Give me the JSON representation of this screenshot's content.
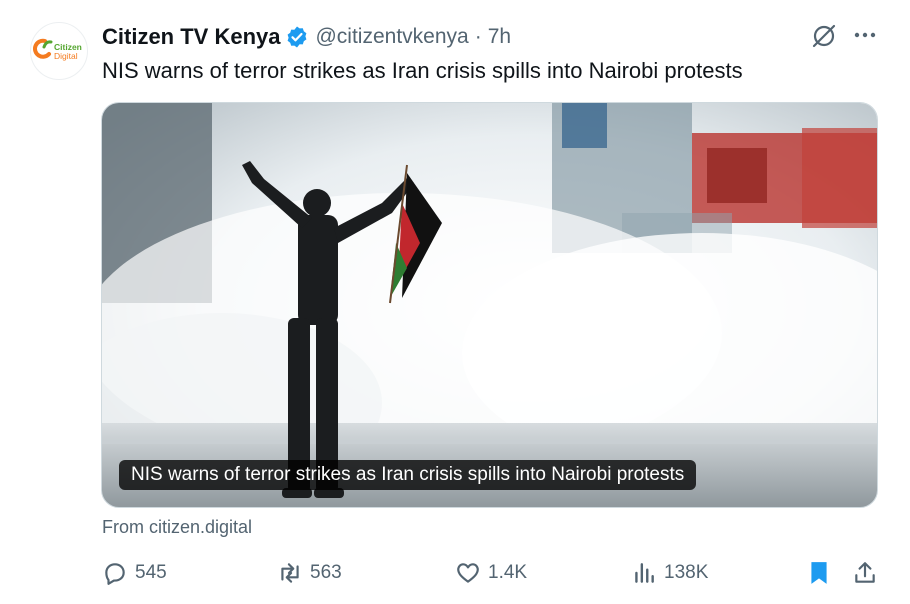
{
  "post": {
    "author_name": "Citizen TV Kenya",
    "handle": "@citizentvkenya",
    "separator": "·",
    "time": "7h",
    "text": "NIS warns of terror strikes as Iran crisis spills into Nairobi protests",
    "avatar_logo_text": [
      "Citizen",
      "Digital"
    ]
  },
  "card": {
    "caption": "NIS warns of terror strikes as Iran crisis spills into Nairobi protests",
    "source": "From citizen.digital"
  },
  "actions": {
    "replies": "545",
    "reposts": "563",
    "likes": "1.4K",
    "views": "138K"
  },
  "icons": {
    "verified": "verified-badge-icon",
    "grok": "grok-icon",
    "more": "more-options-icon",
    "reply": "reply-icon",
    "repost": "repost-icon",
    "like": "heart-icon",
    "views": "views-icon",
    "bookmark": "bookmark-icon",
    "share": "share-icon"
  },
  "colors": {
    "verified": "#1d9bf0",
    "bookmark_active": "#1d9bf0",
    "secondary_text": "#536471",
    "logo_orange": "#f47b20",
    "logo_green": "#55a630"
  }
}
